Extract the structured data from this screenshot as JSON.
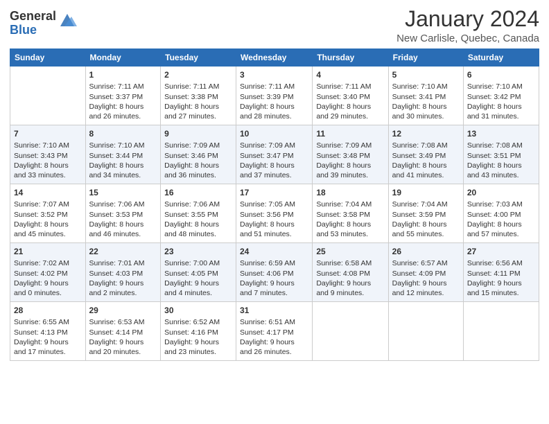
{
  "logo": {
    "general": "General",
    "blue": "Blue"
  },
  "title": "January 2024",
  "location": "New Carlisle, Quebec, Canada",
  "days_of_week": [
    "Sunday",
    "Monday",
    "Tuesday",
    "Wednesday",
    "Thursday",
    "Friday",
    "Saturday"
  ],
  "weeks": [
    [
      {
        "day": "",
        "content": ""
      },
      {
        "day": "1",
        "content": "Sunrise: 7:11 AM\nSunset: 3:37 PM\nDaylight: 8 hours\nand 26 minutes."
      },
      {
        "day": "2",
        "content": "Sunrise: 7:11 AM\nSunset: 3:38 PM\nDaylight: 8 hours\nand 27 minutes."
      },
      {
        "day": "3",
        "content": "Sunrise: 7:11 AM\nSunset: 3:39 PM\nDaylight: 8 hours\nand 28 minutes."
      },
      {
        "day": "4",
        "content": "Sunrise: 7:11 AM\nSunset: 3:40 PM\nDaylight: 8 hours\nand 29 minutes."
      },
      {
        "day": "5",
        "content": "Sunrise: 7:10 AM\nSunset: 3:41 PM\nDaylight: 8 hours\nand 30 minutes."
      },
      {
        "day": "6",
        "content": "Sunrise: 7:10 AM\nSunset: 3:42 PM\nDaylight: 8 hours\nand 31 minutes."
      }
    ],
    [
      {
        "day": "7",
        "content": "Sunrise: 7:10 AM\nSunset: 3:43 PM\nDaylight: 8 hours\nand 33 minutes."
      },
      {
        "day": "8",
        "content": "Sunrise: 7:10 AM\nSunset: 3:44 PM\nDaylight: 8 hours\nand 34 minutes."
      },
      {
        "day": "9",
        "content": "Sunrise: 7:09 AM\nSunset: 3:46 PM\nDaylight: 8 hours\nand 36 minutes."
      },
      {
        "day": "10",
        "content": "Sunrise: 7:09 AM\nSunset: 3:47 PM\nDaylight: 8 hours\nand 37 minutes."
      },
      {
        "day": "11",
        "content": "Sunrise: 7:09 AM\nSunset: 3:48 PM\nDaylight: 8 hours\nand 39 minutes."
      },
      {
        "day": "12",
        "content": "Sunrise: 7:08 AM\nSunset: 3:49 PM\nDaylight: 8 hours\nand 41 minutes."
      },
      {
        "day": "13",
        "content": "Sunrise: 7:08 AM\nSunset: 3:51 PM\nDaylight: 8 hours\nand 43 minutes."
      }
    ],
    [
      {
        "day": "14",
        "content": "Sunrise: 7:07 AM\nSunset: 3:52 PM\nDaylight: 8 hours\nand 45 minutes."
      },
      {
        "day": "15",
        "content": "Sunrise: 7:06 AM\nSunset: 3:53 PM\nDaylight: 8 hours\nand 46 minutes."
      },
      {
        "day": "16",
        "content": "Sunrise: 7:06 AM\nSunset: 3:55 PM\nDaylight: 8 hours\nand 48 minutes."
      },
      {
        "day": "17",
        "content": "Sunrise: 7:05 AM\nSunset: 3:56 PM\nDaylight: 8 hours\nand 51 minutes."
      },
      {
        "day": "18",
        "content": "Sunrise: 7:04 AM\nSunset: 3:58 PM\nDaylight: 8 hours\nand 53 minutes."
      },
      {
        "day": "19",
        "content": "Sunrise: 7:04 AM\nSunset: 3:59 PM\nDaylight: 8 hours\nand 55 minutes."
      },
      {
        "day": "20",
        "content": "Sunrise: 7:03 AM\nSunset: 4:00 PM\nDaylight: 8 hours\nand 57 minutes."
      }
    ],
    [
      {
        "day": "21",
        "content": "Sunrise: 7:02 AM\nSunset: 4:02 PM\nDaylight: 9 hours\nand 0 minutes."
      },
      {
        "day": "22",
        "content": "Sunrise: 7:01 AM\nSunset: 4:03 PM\nDaylight: 9 hours\nand 2 minutes."
      },
      {
        "day": "23",
        "content": "Sunrise: 7:00 AM\nSunset: 4:05 PM\nDaylight: 9 hours\nand 4 minutes."
      },
      {
        "day": "24",
        "content": "Sunrise: 6:59 AM\nSunset: 4:06 PM\nDaylight: 9 hours\nand 7 minutes."
      },
      {
        "day": "25",
        "content": "Sunrise: 6:58 AM\nSunset: 4:08 PM\nDaylight: 9 hours\nand 9 minutes."
      },
      {
        "day": "26",
        "content": "Sunrise: 6:57 AM\nSunset: 4:09 PM\nDaylight: 9 hours\nand 12 minutes."
      },
      {
        "day": "27",
        "content": "Sunrise: 6:56 AM\nSunset: 4:11 PM\nDaylight: 9 hours\nand 15 minutes."
      }
    ],
    [
      {
        "day": "28",
        "content": "Sunrise: 6:55 AM\nSunset: 4:13 PM\nDaylight: 9 hours\nand 17 minutes."
      },
      {
        "day": "29",
        "content": "Sunrise: 6:53 AM\nSunset: 4:14 PM\nDaylight: 9 hours\nand 20 minutes."
      },
      {
        "day": "30",
        "content": "Sunrise: 6:52 AM\nSunset: 4:16 PM\nDaylight: 9 hours\nand 23 minutes."
      },
      {
        "day": "31",
        "content": "Sunrise: 6:51 AM\nSunset: 4:17 PM\nDaylight: 9 hours\nand 26 minutes."
      },
      {
        "day": "",
        "content": ""
      },
      {
        "day": "",
        "content": ""
      },
      {
        "day": "",
        "content": ""
      }
    ]
  ]
}
